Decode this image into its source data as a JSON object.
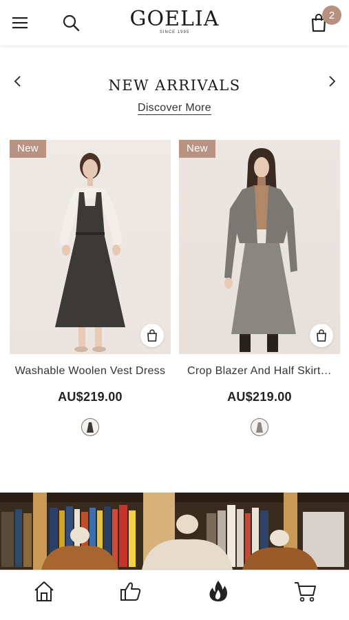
{
  "header": {
    "menu_icon": "hamburger-menu-icon",
    "search_icon": "search-icon",
    "logo_text": "GOELIA",
    "logo_subtext": "SINCE 1995",
    "cart_icon": "shopping-bag-icon",
    "cart_count": "2",
    "badge_color": "#b8907f"
  },
  "section": {
    "title": "NEW ARRIVALS",
    "link_label": "Discover More",
    "prev_icon": "chevron-left-icon",
    "next_icon": "chevron-right-icon"
  },
  "products": [
    {
      "tag": "New",
      "name": "Washable Woolen Vest Dress",
      "price": "AU$219.00",
      "cart_icon": "shopping-bag-icon",
      "tag_color": "#b99381"
    },
    {
      "tag": "New",
      "name": "Crop Blazer And Half Skirt…",
      "price": "AU$219.00",
      "cart_icon": "shopping-bag-icon",
      "tag_color": "#b99381"
    }
  ],
  "bottom_nav": {
    "items": [
      {
        "icon": "home-icon"
      },
      {
        "icon": "thumbs-up-icon"
      },
      {
        "icon": "flame-icon"
      },
      {
        "icon": "cart-icon"
      }
    ]
  }
}
